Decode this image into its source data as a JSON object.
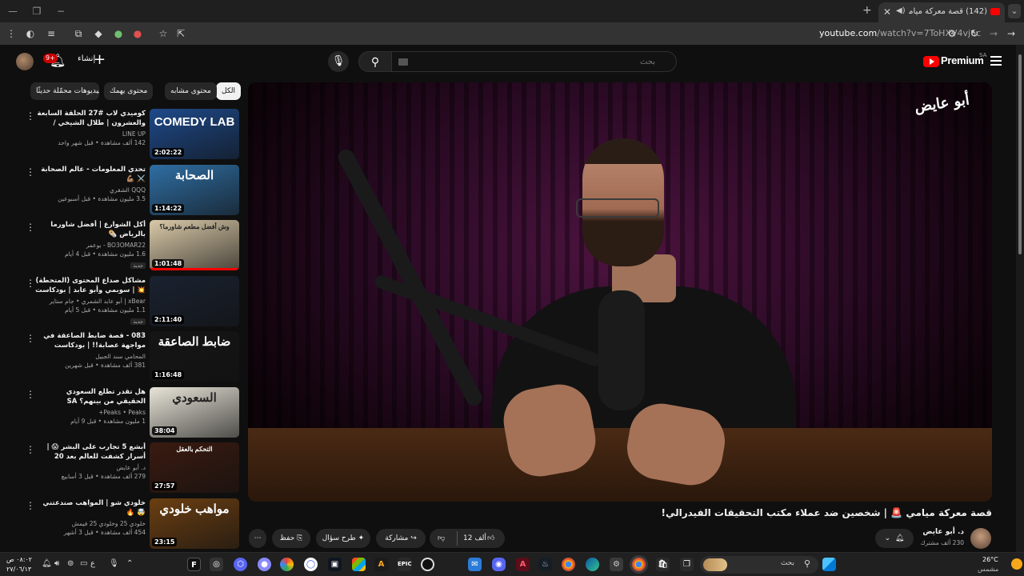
{
  "browser": {
    "tab_title": "(142) قصة معركة ميامي",
    "url_host": "youtube.com",
    "url_path": "/watch?v=7ToHXV4vj6c"
  },
  "header": {
    "create_label": "إنشاء",
    "notif_count": "9+",
    "search_placeholder": "بحث",
    "logo_word": "Premium",
    "country": "SA"
  },
  "chips": [
    "الكل",
    "محتوى مشابه",
    "محتوى يهمك",
    "فيديوهات محمّلة حديثًا"
  ],
  "videos": [
    {
      "title": "كوميدي لاب #27 الحلقة السابعة والعشرون | طلال الشيخي / بدران وضيوف الحلقة ابرا...",
      "channel": "LINE UP",
      "stats": "142 ألف مشاهدة • قبل شهر واحد",
      "badge": "",
      "duration": "2:02:22",
      "thumb_text": "COMEDY LAB",
      "thumb_color": "#1e4a8a",
      "progress": 0
    },
    {
      "title": "تحدي المعلومات - عالم الصحابة ⚔️ 💪🏽",
      "channel": "QQQ الشقري",
      "stats": "3.5 مليون مشاهدة • قبل أسبوعين",
      "badge": "",
      "duration": "1:14:22",
      "thumb_text": "الصحابة",
      "thumb_color": "#2f6ea3",
      "progress": 0
    },
    {
      "title": "أكل الشوارع | أفضل شاورما بالرياض 🌯",
      "channel": "BO3OMAR22 - بوعمر",
      "stats": "1.6 مليون مشاهدة • قبل 4 أيام",
      "badge": "جديد",
      "duration": "1:01:48",
      "thumb_text": "وش أفضل مطعم شاورما؟",
      "thumb_color": "#d9c9a8",
      "progress": 1.0
    },
    {
      "title": "مشاكل صداع المحتوى (المتحطة) 💥 | سوبمي وأبو عابد | بودكاست بسير خير",
      "channel": "xBear | أبو عابد الشمري • جام ستاير",
      "stats": "1.1 مليون مشاهدة • قبل 5 أيام",
      "badge": "جديد",
      "duration": "2:11:40",
      "thumb_text": "",
      "thumb_color": "#1a2230",
      "progress": 0
    },
    {
      "title": "083 - قصة ضابط الصاعقة في مواجهة عصابة!! | بودكاست مثورات قضائية",
      "channel": "المحامي سند الجبيل",
      "stats": "381 ألف مشاهدة • قبل شهرين",
      "badge": "",
      "duration": "1:16:48",
      "thumb_text": "ضابط الصاعقة",
      "thumb_color": "#151515",
      "progress": 0
    },
    {
      "title": "هل تقدر تطلع السعودي الحقيقي من بينهم؟ SA",
      "channel": "Peaks • Peaks+",
      "stats": "1 مليون مشاهدة • قبل 9 أيام",
      "badge": "",
      "duration": "38:04",
      "thumb_text": "السعودي",
      "thumb_color": "#e8e4d8",
      "progress": 0
    },
    {
      "title": "أبشع 5 تجارب على البشر 😱 | أسرار كشفت للعالم بعد 20 سنة؟",
      "channel": "د. أبو عايض",
      "stats": "279 ألف مشاهدة • قبل 3 أسابيع",
      "badge": "",
      "duration": "27:57",
      "thumb_text": "التحكم بالعقل",
      "thumb_color": "#3a1a10",
      "progress": 0
    },
    {
      "title": "خلودي شو | المواهب صندعتني 🤯 🔥",
      "channel": "خلودي 25 وخلودي 25 فيمش",
      "stats": "454 ألف مشاهدة • قبل 3 أشهر",
      "badge": "",
      "duration": "23:15",
      "thumb_text": "مواهب خلودي",
      "thumb_color": "#6b3f12",
      "progress": 0
    }
  ],
  "player": {
    "watermark": "أبو عايض"
  },
  "video": {
    "title": "قصة معركة ميامي 🚨 | شخصين ضد عملاء مكتب التحقيقات الفيدرالي!",
    "channel_name": "د. أبو عايض",
    "channel_subs": "230 ألف مشترك",
    "likes": "12 ألف",
    "share_label": "مشاركة",
    "ask_label": "طرح سؤال",
    "save_label": "حفظ"
  },
  "taskbar": {
    "search_label": "بحث",
    "time": "٠٨:٠٢ ص",
    "date": "٢٧/٠٦/١٣",
    "lang": "ع",
    "temp": "26°C",
    "condition": "مشمس"
  }
}
